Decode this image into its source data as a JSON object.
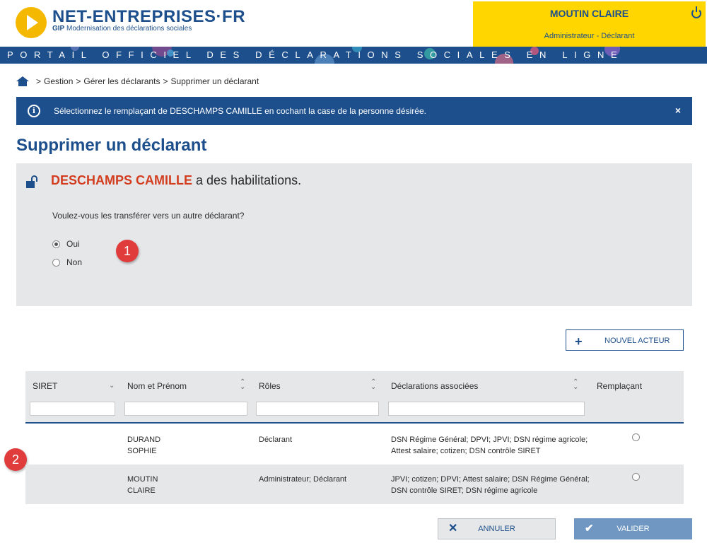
{
  "header": {
    "brand": "NET-ENTREPRISES·FR",
    "brand_sub_prefix": "GIP",
    "brand_sub": "Modernisation des déclarations sociales",
    "user_name": "MOUTIN CLAIRE",
    "user_role": "Administrateur - Déclarant",
    "banner": "PORTAIL OFFICIEL DES DÉCLARATIONS SOCIALES EN LIGNE",
    "colors": {
      "brand": "#1d4f8c",
      "user_box": "#ffd600",
      "logo": "#f5b800"
    }
  },
  "breadcrumb": [
    "Gestion",
    "Gérer les déclarants",
    "Supprimer un déclarant"
  ],
  "info": {
    "text": "Sélectionnez le remplaçant de DESCHAMPS CAMILLE en cochant la case de la personne désirée.",
    "close": "×"
  },
  "page_title": "Supprimer un déclarant",
  "panel": {
    "person": "DESCHAMPS CAMILLE",
    "suffix": "a des habilitations.",
    "question": "Voulez-vous les transférer vers un autre déclarant?",
    "options": [
      {
        "label": "Oui",
        "selected": true
      },
      {
        "label": "Non",
        "selected": false
      }
    ]
  },
  "badges": [
    "1",
    "2"
  ],
  "new_actor_label": "NOUVEL ACTEUR",
  "table": {
    "columns": [
      "SIRET",
      "Nom et Prénom",
      "Rôles",
      "Déclarations associées",
      "Remplaçant"
    ],
    "rows": [
      {
        "siret": "",
        "name_line1": "DURAND",
        "name_line2": "SOPHIE",
        "roles": "Déclarant",
        "decl_line1": "DSN Régime Général; DPVI; JPVI; DSN régime agricole;",
        "decl_line2": "Attest salaire; cotizen; DSN contrôle SIRET"
      },
      {
        "siret": "",
        "name_line1": "MOUTIN",
        "name_line2": "CLAIRE",
        "roles": "Administrateur; Déclarant",
        "decl_line1": "JPVI; cotizen; DPVI; Attest salaire; DSN Régime Général;",
        "decl_line2": "DSN contrôle SIRET; DSN régime agricole"
      }
    ]
  },
  "footer": {
    "cancel_label": "ANNULER",
    "validate_label": "VALIDER"
  }
}
